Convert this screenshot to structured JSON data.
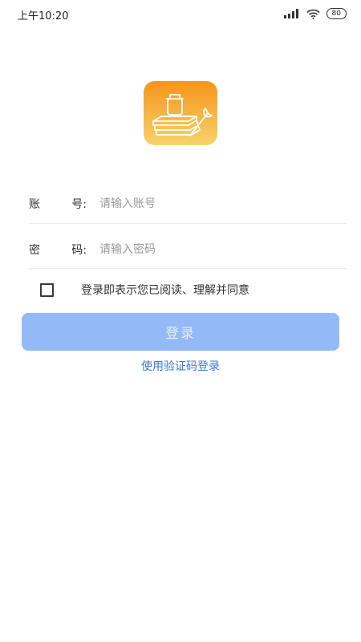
{
  "status_bar": {
    "time": "上午10:20",
    "battery": "80",
    "icons": [
      "signal-icon",
      "wifi-icon",
      "battery-icon"
    ]
  },
  "logo": {
    "icon": "books-and-wrench-logo",
    "colors": {
      "top": "#f6951c",
      "bottom": "#f7d26a"
    }
  },
  "form": {
    "account": {
      "label_left": "账",
      "label_right": "号:",
      "placeholder": "请输入账号"
    },
    "password": {
      "label_left": "密",
      "label_right": "码:",
      "placeholder": "请输入密码"
    }
  },
  "agreement": {
    "text": "登录即表示您已阅读、理解并同意"
  },
  "login_button": {
    "label": "登录",
    "color": "#94b9f7"
  },
  "sms_login": {
    "label": "使用验证码登录",
    "color": "#3b77d6"
  }
}
